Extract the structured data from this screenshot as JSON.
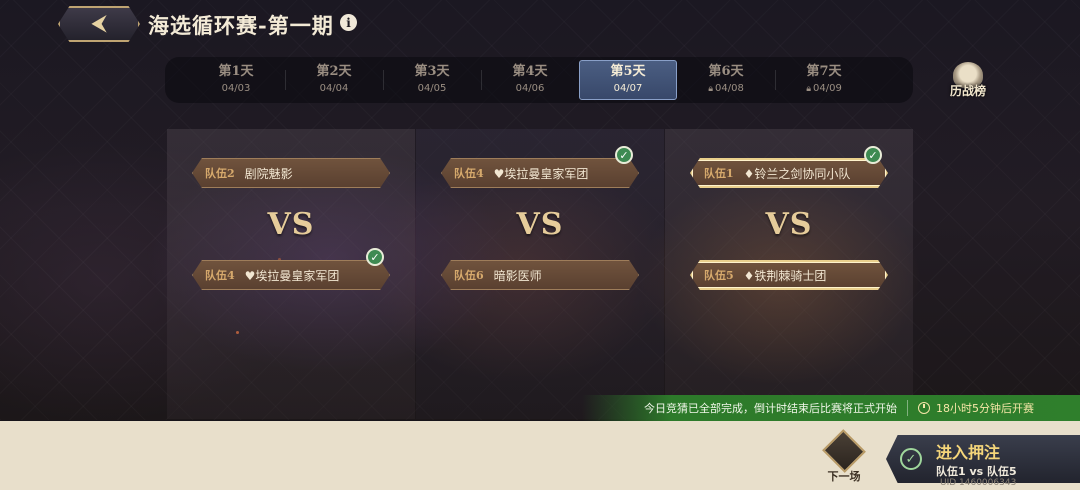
{
  "header": {
    "title": "海选循环赛-第一期",
    "back_icon": "back-arrow-icon",
    "info_glyph": "i"
  },
  "tabs": [
    {
      "day": "第1天",
      "date": "04/03",
      "locked": false,
      "active": false
    },
    {
      "day": "第2天",
      "date": "04/04",
      "locked": false,
      "active": false
    },
    {
      "day": "第3天",
      "date": "04/05",
      "locked": false,
      "active": false
    },
    {
      "day": "第4天",
      "date": "04/06",
      "locked": false,
      "active": false
    },
    {
      "day": "第5天",
      "date": "04/07",
      "locked": false,
      "active": true
    },
    {
      "day": "第6天",
      "date": "04/08",
      "locked": true,
      "active": false
    },
    {
      "day": "第7天",
      "date": "04/09",
      "locked": true,
      "active": false
    }
  ],
  "rank_button": {
    "label": "历战榜"
  },
  "matches": [
    {
      "vs": "VS",
      "top": {
        "index": "队伍2",
        "name": "剧院魅影",
        "symbol": "",
        "winner": false,
        "checked": false
      },
      "bottom": {
        "index": "队伍4",
        "name": "埃拉曼皇家军团",
        "symbol": "♥",
        "winner": false,
        "checked": true
      }
    },
    {
      "vs": "VS",
      "top": {
        "index": "队伍4",
        "name": "埃拉曼皇家军团",
        "symbol": "♥",
        "winner": false,
        "checked": true
      },
      "bottom": {
        "index": "队伍6",
        "name": "暗影医师",
        "symbol": "",
        "winner": false,
        "checked": false
      }
    },
    {
      "vs": "VS",
      "top": {
        "index": "队伍1",
        "name": "铃兰之剑协同小队",
        "symbol": "♦",
        "winner": true,
        "checked": true
      },
      "bottom": {
        "index": "队伍5",
        "name": "铁荆棘骑士团",
        "symbol": "♦",
        "winner": true,
        "checked": false
      }
    }
  ],
  "notice": {
    "message": "今日竞猜已全部完成，倒计时结束后比赛将正式开始",
    "timer": "18小时5分钟后开赛"
  },
  "bottom": {
    "next_label": "下一场",
    "enter_main": "进入押注",
    "enter_sub": "队伍1 vs 队伍5",
    "uid": "UID 1460006343"
  },
  "colors": {
    "accent_gold": "#e9cf8c",
    "team_plate": "#70533d",
    "active_tab": "#4b5e82",
    "notice_green": "#2f7f2c",
    "enter_gold": "#f5d67a"
  }
}
